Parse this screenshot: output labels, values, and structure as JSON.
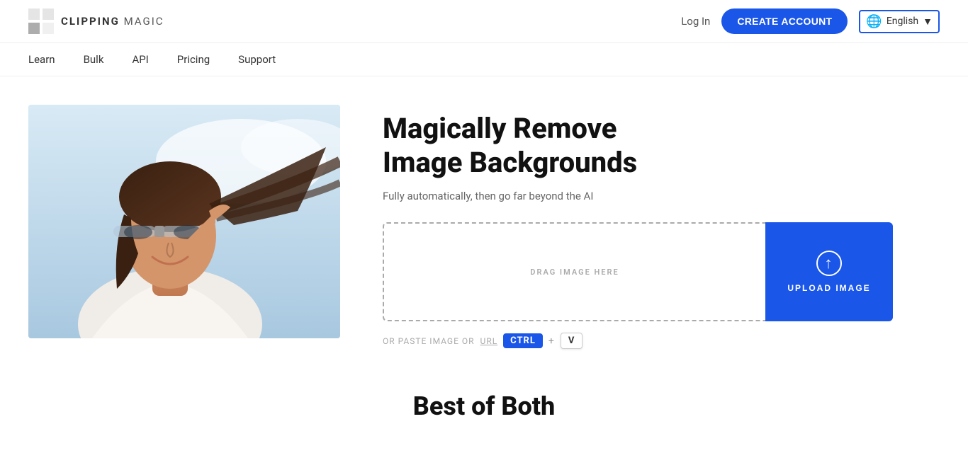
{
  "header": {
    "logo_text_bold": "CLIPPING",
    "logo_text_light": " MAGIC",
    "login_label": "Log In",
    "create_account_label": "CREATE ACCOUNT",
    "language_label": "English",
    "language_chevron": "▼"
  },
  "nav": {
    "items": [
      {
        "id": "learn",
        "label": "Learn"
      },
      {
        "id": "bulk",
        "label": "Bulk"
      },
      {
        "id": "api",
        "label": "API"
      },
      {
        "id": "pricing",
        "label": "Pricing"
      },
      {
        "id": "support",
        "label": "Support"
      }
    ]
  },
  "hero": {
    "title_line1": "Magically Remove",
    "title_line2": "Image Backgrounds",
    "subtitle": "Fully automatically, then go far beyond the AI",
    "drag_label": "DRAG IMAGE HERE",
    "upload_label": "UPLOAD IMAGE",
    "paste_hint_text": "OR PASTE IMAGE OR",
    "url_label": "URL",
    "ctrl_label": "CTRL",
    "v_label": "V",
    "plus_label": "+"
  },
  "bottom": {
    "title": "Best of Both"
  },
  "icons": {
    "globe": "🌐",
    "upload_arrow": "↑"
  }
}
